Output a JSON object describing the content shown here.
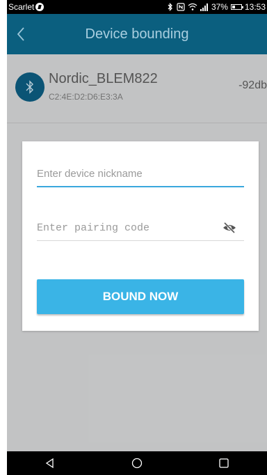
{
  "status_bar": {
    "carrier": "Scarlet",
    "battery_text": "37%",
    "battery_level": 0.37,
    "time": "13:53"
  },
  "app_bar": {
    "title": "Device bounding"
  },
  "device": {
    "name": "Nordic_BLEM822",
    "mac": "C2:4E:D2:D6:E3:3A",
    "rssi": "-92db"
  },
  "dialog": {
    "nickname_placeholder": "Enter device nickname",
    "nickname_value": "",
    "pairing_placeholder": "Enter pairing code",
    "pairing_value": "",
    "button_label": "BOUND NOW"
  },
  "colors": {
    "app_bar": "#0b5f7f",
    "accent": "#3ab4e6",
    "input_focus": "#3aa7dd"
  },
  "icons": {
    "back": "chevron-left-icon",
    "bluetooth": "bluetooth-icon",
    "visibility": "visibility-off-icon",
    "nav_back": "triangle-back-icon",
    "nav_home": "circle-home-icon",
    "nav_recents": "square-recents-icon"
  }
}
